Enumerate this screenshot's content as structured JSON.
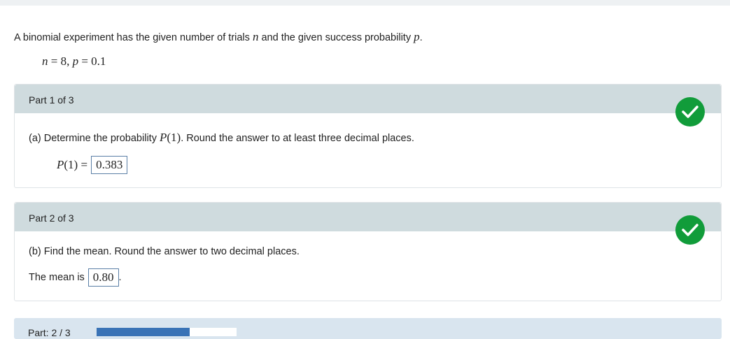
{
  "intro": {
    "text_before_n": "A binomial experiment has the given number of trials",
    "n_symbol": "n",
    "text_middle": "and the given success probability",
    "p_symbol": "p",
    "end": "."
  },
  "given": {
    "n_var": "n",
    "eq1": " = 8, ",
    "p_var": "p",
    "eq2": " = 0.1"
  },
  "part1": {
    "label": "Part 1 of 3",
    "question_before": "(a) Determine the probability",
    "question_math_P": "P",
    "question_math_arg": "(1)",
    "question_after": ". Round the answer to at least three decimal places.",
    "answer_P": "P",
    "answer_prefix": " (1) = ",
    "answer_value": "0.383",
    "status": "correct"
  },
  "part2": {
    "label": "Part 2 of 3",
    "question": "(b) Find the mean. Round the answer to two decimal places.",
    "answer_prefix": "The mean is",
    "answer_value": "0.80",
    "answer_suffix": ".",
    "status": "correct"
  },
  "part3": {
    "label": "Part: 2 / 3",
    "progress_fraction": 0.667
  },
  "colors": {
    "check": "#119c3a",
    "header": "#cfdbde",
    "progress": "#3a73b6"
  },
  "icons": {
    "status": "check-circle-icon"
  }
}
